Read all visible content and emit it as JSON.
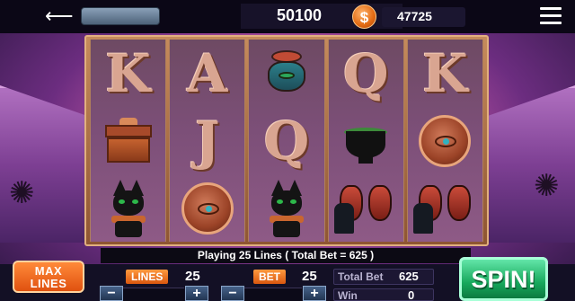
{
  "topbar": {
    "balance": "50100",
    "coin_symbol": "$",
    "coins": "47725"
  },
  "reels": [
    [
      "K",
      "chest",
      "cat"
    ],
    [
      "A",
      "J",
      "amulet"
    ],
    [
      "vase",
      "Q",
      "cat"
    ],
    [
      "Q",
      "cauldron",
      "catvase"
    ],
    [
      "K",
      "amulet",
      "catvase"
    ]
  ],
  "status": "Playing 25 Lines ( Total Bet = 625 )",
  "controls": {
    "max_lines_label_1": "MAX",
    "max_lines_label_2": "LINES",
    "lines_label": "LINES",
    "lines_value": "25",
    "bet_label": "BET",
    "bet_value": "25",
    "minus": "−",
    "plus": "+",
    "total_bet_label": "Total Bet",
    "total_bet_value": "625",
    "win_label": "Win",
    "win_value": "0",
    "spin_label": "SPIN!"
  },
  "colors": {
    "accent_orange": "#e0510f",
    "spin_green": "#17a85c",
    "coin": "#e26a12"
  }
}
